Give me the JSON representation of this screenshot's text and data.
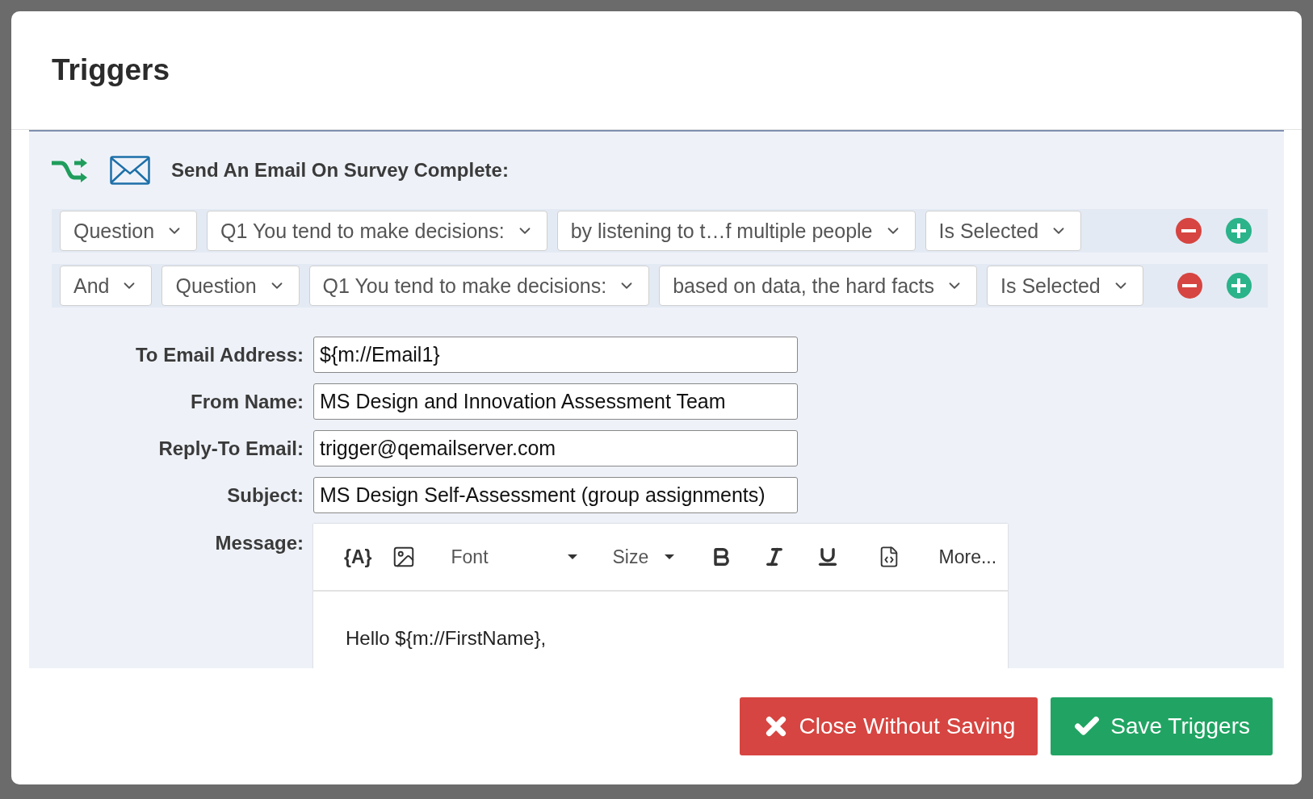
{
  "modal": {
    "title": "Triggers"
  },
  "trigger": {
    "heading": "Send An Email On Survey Complete:"
  },
  "conditions": [
    {
      "dropdowns": [
        "Question",
        "Q1 You tend to make decisions:",
        "by listening to t…f multiple people",
        "Is Selected"
      ]
    },
    {
      "dropdowns": [
        "And",
        "Question",
        "Q1 You tend to make decisions:",
        "based on data, the hard facts",
        "Is Selected"
      ]
    }
  ],
  "fields": [
    {
      "label": "To Email Address:",
      "value": "${m://Email1}"
    },
    {
      "label": "From Name:",
      "value": "MS Design and Innovation Assessment Team"
    },
    {
      "label": "Reply-To Email:",
      "value": "trigger@qemailserver.com"
    },
    {
      "label": "Subject:",
      "value": "MS Design Self-Assessment (group assignments)"
    }
  ],
  "message": {
    "label": "Message:",
    "toolbar": [
      {
        "kind": "piped",
        "label": "{A}"
      },
      {
        "kind": "image"
      },
      {
        "kind": "dropdown",
        "label": "Font"
      },
      {
        "kind": "dropdown",
        "label": "Size"
      },
      {
        "kind": "bold"
      },
      {
        "kind": "italic"
      },
      {
        "kind": "underline"
      },
      {
        "kind": "source"
      },
      {
        "kind": "more",
        "label": "More..."
      }
    ],
    "body": "Hello ${m://FirstName},"
  },
  "footer": {
    "buttons": [
      {
        "kind": "cancel",
        "label": "Close Without Saving"
      },
      {
        "kind": "save",
        "label": "Save Triggers"
      }
    ]
  }
}
